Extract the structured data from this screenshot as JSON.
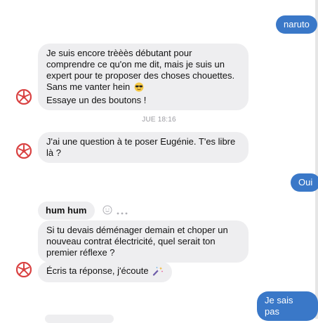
{
  "colors": {
    "outgoing_bubble": "#3a78c8",
    "incoming_bubble": "#eeeef0",
    "timestamp": "#9a9aa0",
    "avatar_red": "#d94141"
  },
  "messages": {
    "out_naruto": "naruto",
    "in_intro": {
      "line1": "Je suis encore trèèès débutant pour",
      "line2": "comprendre ce qu'on me dit, mais je suis un",
      "line3": "expert pour te proposer des choses chouettes.",
      "line4": "Sans me vanter hein",
      "line5": "Essaye un des boutons !"
    },
    "timestamp": "JUE 18:16",
    "in_question": {
      "line1": "J'ai une question à te poser Eugénie. T'es libre",
      "line2": "là ?"
    },
    "out_oui": "Oui",
    "in_humhum": "hum hum",
    "in_move": {
      "line1": "Si tu devais déménager demain et choper un",
      "line2": "nouveau contrat électricité, quel serait ton",
      "line3": "premier réflexe ?"
    },
    "in_write": "Écris ta réponse, j'écoute",
    "out_jesaispas": "Je sais pas"
  },
  "icons": {
    "avatar": "bot-avatar-icon",
    "sunglasses": "sunglasses-emoji-icon",
    "magic": "magic-wand-emoji-icon",
    "react": "smiley-react-icon",
    "more": "more-dots-icon"
  }
}
